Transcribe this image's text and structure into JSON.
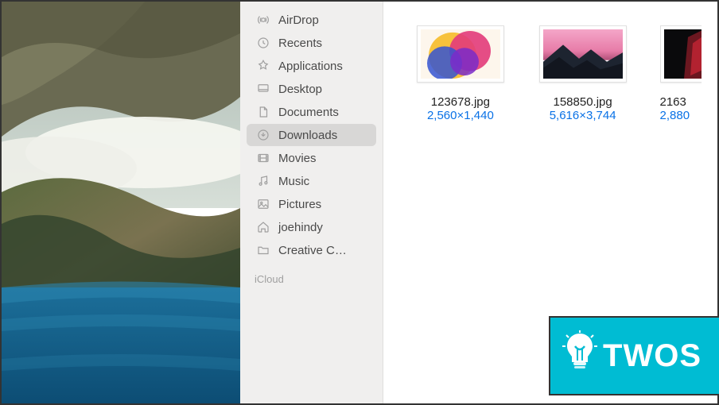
{
  "sidebar": {
    "items": [
      {
        "label": "AirDrop",
        "icon": "airdrop-icon",
        "active": false
      },
      {
        "label": "Recents",
        "icon": "clock-icon",
        "active": false
      },
      {
        "label": "Applications",
        "icon": "apps-icon",
        "active": false
      },
      {
        "label": "Desktop",
        "icon": "desktop-icon",
        "active": false
      },
      {
        "label": "Documents",
        "icon": "document-icon",
        "active": false
      },
      {
        "label": "Downloads",
        "icon": "download-icon",
        "active": true
      },
      {
        "label": "Movies",
        "icon": "movies-icon",
        "active": false
      },
      {
        "label": "Music",
        "icon": "music-icon",
        "active": false
      },
      {
        "label": "Pictures",
        "icon": "pictures-icon",
        "active": false
      },
      {
        "label": "joehindy",
        "icon": "home-icon",
        "active": false
      },
      {
        "label": "Creative C…",
        "icon": "folder-icon",
        "active": false
      }
    ],
    "section_header": "iCloud"
  },
  "files": [
    {
      "name": "123678.jpg",
      "dimensions": "2,560×1,440",
      "thumb": "abstract-colorful"
    },
    {
      "name": "158850.jpg",
      "dimensions": "5,616×3,744",
      "thumb": "mountain-sunset"
    },
    {
      "name": "2163",
      "dimensions": "2,880",
      "thumb": "dark-red",
      "clipped": true
    }
  ],
  "badge": {
    "text": "TWOS"
  },
  "colors": {
    "link": "#0971e6",
    "badge_bg": "#00bcd3",
    "sidebar_bg": "#f0efee",
    "active_bg": "#d8d7d6"
  }
}
